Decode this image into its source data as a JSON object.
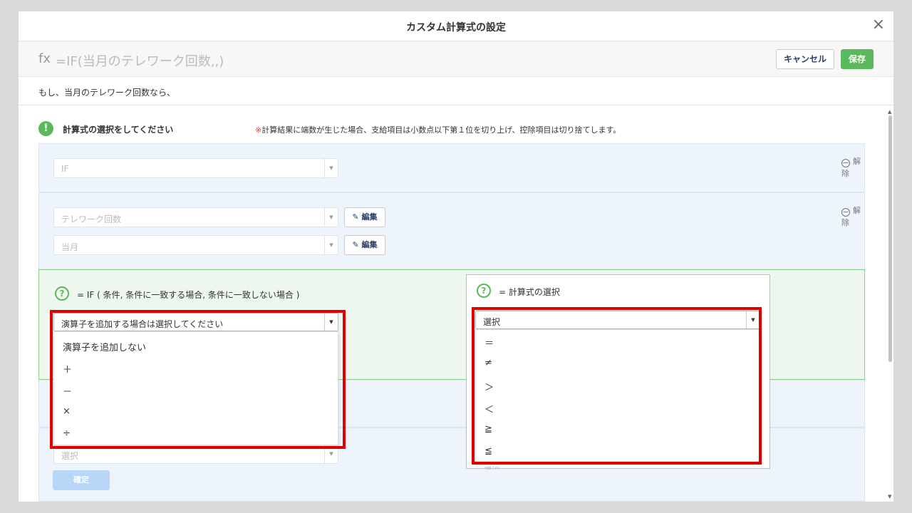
{
  "modal": {
    "title": "カスタム計算式の設定",
    "close_label": "×"
  },
  "formula_bar": {
    "fx_label": "fx",
    "formula": "=IF(当月のテレワーク回数,,)",
    "cancel_label": "キャンセル",
    "save_label": "保存"
  },
  "description": "もし、当月のテレワーク回数なら、",
  "section": {
    "icon": "!",
    "title": "計算式の選択をしてください",
    "note_mark": "※",
    "note": "計算結果に端数が生じた場合、支給項目は小数点以下第１位を切り上げ、控除項目は切り捨てします。"
  },
  "panel1": {
    "select_value": "IF",
    "release_label": "解除"
  },
  "panel2": {
    "select1_value": "テレワーク回数",
    "select2_value": "当月",
    "edit_label": "編集",
    "release_label": "解除"
  },
  "panel3": {
    "help_icon": "?",
    "if_text": "= IF ( 条件, 条件に一致する場合, 条件に一致しない場合 )",
    "operator_select_value": "演算子を追加する場合は選択してください",
    "operator_options": [
      "演算子を追加しない",
      "＋",
      "－",
      "×",
      "÷"
    ]
  },
  "popup": {
    "help_icon": "?",
    "title": "= 計算式の選択",
    "select_value": "選択",
    "options": [
      "＝",
      "≠",
      "＞",
      "＜",
      "≧",
      "≦"
    ],
    "hidden_select_value": "選択"
  },
  "panel5": {
    "select_value": "選択",
    "confirm_label": "確定"
  },
  "icons": {
    "close": "close-icon",
    "edit": "pencil-icon",
    "release": "minus-circle-icon",
    "caret": "chevron-down-icon",
    "help": "question-circle-icon",
    "alert": "exclamation-circle-icon"
  },
  "colors": {
    "accent_green": "#5cb85c",
    "highlight_red": "#e00000",
    "panel_blue": "#eef4fc",
    "panel_green": "#eef7ee"
  }
}
